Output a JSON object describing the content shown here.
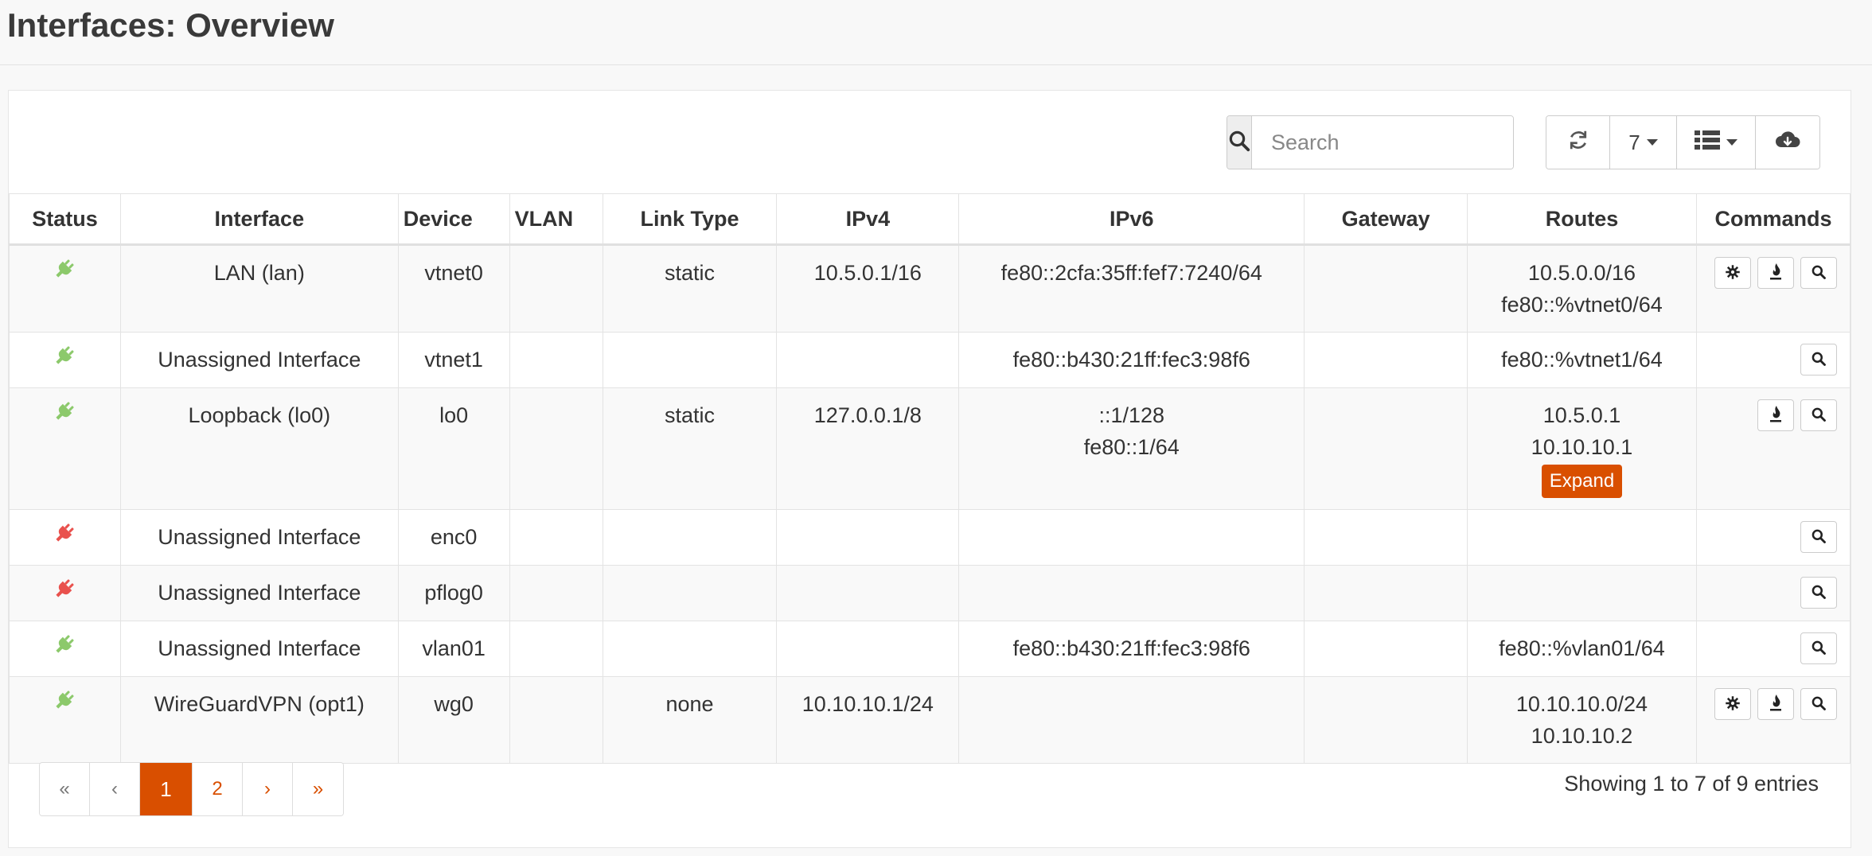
{
  "page": {
    "title": "Interfaces: Overview"
  },
  "toolbar": {
    "search_placeholder": "Search",
    "page_size": "7",
    "icons": [
      "search-icon",
      "refresh-icon",
      "columns-list-icon",
      "cloud-download-icon"
    ]
  },
  "columns": [
    "Status",
    "Interface",
    "Device",
    "VLAN",
    "Link Type",
    "IPv4",
    "IPv6",
    "Gateway",
    "Routes",
    "Commands"
  ],
  "colors": {
    "accent": "#d94f00",
    "status_up": "#8cc96b",
    "status_down": "#e9514d"
  },
  "rows": [
    {
      "status": "up",
      "interface": "LAN (lan)",
      "device": "vtnet0",
      "vlan": "",
      "link_type": "static",
      "ipv4": "10.5.0.1/16",
      "ipv6": [
        "fe80::2cfa:35ff:fef7:7240/64"
      ],
      "gateway": "",
      "routes": [
        "10.5.0.0/16",
        "fe80::%vtnet0/64"
      ],
      "commands": [
        "configure",
        "firewall",
        "inspect"
      ]
    },
    {
      "status": "up",
      "interface": "Unassigned Interface",
      "device": "vtnet1",
      "vlan": "",
      "link_type": "",
      "ipv4": "",
      "ipv6": [
        "fe80::b430:21ff:fec3:98f6"
      ],
      "gateway": "",
      "routes": [
        "fe80::%vtnet1/64"
      ],
      "commands": [
        "inspect"
      ]
    },
    {
      "status": "up",
      "interface": "Loopback (lo0)",
      "device": "lo0",
      "vlan": "",
      "link_type": "static",
      "ipv4": "127.0.0.1/8",
      "ipv6": [
        "::1/128",
        "fe80::1/64"
      ],
      "gateway": "",
      "routes": [
        "10.5.0.1",
        "10.10.10.1"
      ],
      "routes_expand": "Expand",
      "commands": [
        "firewall",
        "inspect"
      ]
    },
    {
      "status": "down",
      "interface": "Unassigned Interface",
      "device": "enc0",
      "vlan": "",
      "link_type": "",
      "ipv4": "",
      "ipv6": [],
      "gateway": "",
      "routes": [],
      "commands": [
        "inspect"
      ]
    },
    {
      "status": "down",
      "interface": "Unassigned Interface",
      "device": "pflog0",
      "vlan": "",
      "link_type": "",
      "ipv4": "",
      "ipv6": [],
      "gateway": "",
      "routes": [],
      "commands": [
        "inspect"
      ]
    },
    {
      "status": "up",
      "interface": "Unassigned Interface",
      "device": "vlan01",
      "vlan": "",
      "link_type": "",
      "ipv4": "",
      "ipv6": [
        "fe80::b430:21ff:fec3:98f6"
      ],
      "gateway": "",
      "routes": [
        "fe80::%vlan01/64"
      ],
      "commands": [
        "inspect"
      ]
    },
    {
      "status": "up",
      "interface": "WireGuardVPN (opt1)",
      "device": "wg0",
      "vlan": "",
      "link_type": "none",
      "ipv4": "10.10.10.1/24",
      "ipv6": [],
      "gateway": "",
      "routes": [
        "10.10.10.0/24",
        "10.10.10.2"
      ],
      "commands": [
        "configure",
        "firewall",
        "inspect"
      ]
    }
  ],
  "pagination": {
    "first": "«",
    "prev": "‹",
    "pages": [
      "1",
      "2"
    ],
    "current": "1",
    "next": "›",
    "last": "»"
  },
  "footer": {
    "entries_text": "Showing 1 to 7 of 9 entries"
  }
}
